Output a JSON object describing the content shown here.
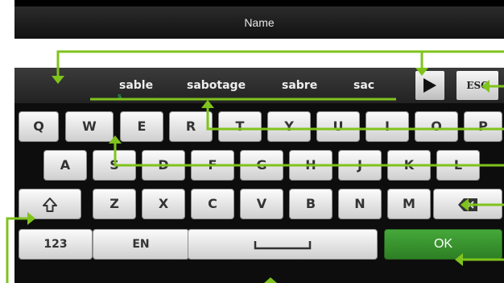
{
  "title": "Name",
  "input": {
    "value": "",
    "placeholder": ""
  },
  "suggestions": [
    "sable",
    "sabotage",
    "sabre",
    "sac"
  ],
  "next_icon": "play-arrow",
  "esc_label": "ESC",
  "mini_char": "s",
  "keys": {
    "row1": [
      "Q",
      "W",
      "E",
      "R",
      "T",
      "Y",
      "U",
      "I",
      "O",
      "P"
    ],
    "row2": [
      "A",
      "S",
      "D",
      "F",
      "G",
      "H",
      "J",
      "K",
      "L"
    ],
    "row3": [
      "Z",
      "X",
      "C",
      "V",
      "B",
      "N",
      "M"
    ],
    "num_label": "123",
    "lang_label": "EN",
    "ok_label": "OK"
  },
  "icons": {
    "shift": "shift-arrow",
    "backspace": "backspace-arrow",
    "space": "space-bracket"
  },
  "colors": {
    "accent": "#2d8a23",
    "callout": "#7fc31c"
  }
}
